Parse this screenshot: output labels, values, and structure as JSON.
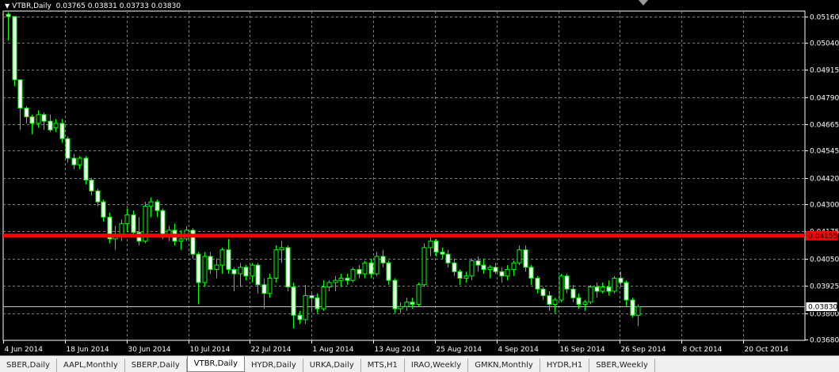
{
  "chart": {
    "symbol_label": "VTBR,Daily",
    "ohlc_label": "0.03765 0.03831 0.03733 0.03830",
    "line_price_label": "0.04155",
    "last_price_label": "0.03830",
    "colors": {
      "background": "#000000",
      "grid": "#7f7f7f",
      "candle": "#00ff00",
      "axis_text": "#ffffff",
      "support_line": "#ff0000"
    }
  },
  "chart_data": {
    "type": "candlestick",
    "title": "VTBR,Daily",
    "y_ticks": [
      "0.05160",
      "0.05040",
      "0.04915",
      "0.04790",
      "0.04665",
      "0.04545",
      "0.04420",
      "0.04300",
      "0.04175",
      "0.04050",
      "0.03925",
      "0.03800",
      "0.03680"
    ],
    "x_ticks": [
      "4 Jun 2014",
      "18 Jun 2014",
      "30 Jun 2014",
      "10 Jul 2014",
      "22 Jul 2014",
      "1 Aug 2014",
      "13 Aug 2014",
      "25 Aug 2014",
      "4 Sep 2014",
      "16 Sep 2014",
      "26 Sep 2014",
      "8 Oct 2014",
      "20 Oct 2014"
    ],
    "ylim": [
      0.0365,
      0.0519
    ],
    "horizontal_line": 0.04155,
    "last_close": 0.0383,
    "candles_ohlc": [
      [
        0.0517,
        0.0518,
        0.0505,
        0.0516
      ],
      [
        0.0516,
        0.0516,
        0.0484,
        0.0487
      ],
      [
        0.0487,
        0.0487,
        0.0464,
        0.0474
      ],
      [
        0.0474,
        0.0475,
        0.0467,
        0.047
      ],
      [
        0.047,
        0.0471,
        0.0462,
        0.0467
      ],
      [
        0.0467,
        0.0473,
        0.0465,
        0.0471
      ],
      [
        0.0471,
        0.0472,
        0.0464,
        0.0468
      ],
      [
        0.0468,
        0.0471,
        0.0463,
        0.0464
      ],
      [
        0.0465,
        0.0469,
        0.0463,
        0.0467
      ],
      [
        0.0467,
        0.0469,
        0.0458,
        0.046
      ],
      [
        0.046,
        0.0461,
        0.0449,
        0.0451
      ],
      [
        0.0451,
        0.0453,
        0.0446,
        0.0448
      ],
      [
        0.0448,
        0.0452,
        0.0446,
        0.0451
      ],
      [
        0.0451,
        0.0452,
        0.0439,
        0.0441
      ],
      [
        0.0441,
        0.0442,
        0.0434,
        0.0436
      ],
      [
        0.0436,
        0.0437,
        0.0429,
        0.0431
      ],
      [
        0.0431,
        0.0432,
        0.0422,
        0.0424
      ],
      [
        0.0424,
        0.0426,
        0.0412,
        0.0414
      ],
      [
        0.0414,
        0.042,
        0.0409,
        0.0416
      ],
      [
        0.0416,
        0.0423,
        0.0413,
        0.0421
      ],
      [
        0.0421,
        0.0428,
        0.0417,
        0.0425
      ],
      [
        0.0425,
        0.0427,
        0.0415,
        0.0417
      ],
      [
        0.0417,
        0.0424,
        0.0411,
        0.0413
      ],
      [
        0.0413,
        0.0431,
        0.0412,
        0.0429
      ],
      [
        0.0429,
        0.0433,
        0.0424,
        0.0431
      ],
      [
        0.0431,
        0.0432,
        0.0424,
        0.0427
      ],
      [
        0.0427,
        0.0428,
        0.0414,
        0.0416
      ],
      [
        0.0416,
        0.042,
        0.0413,
        0.0418
      ],
      [
        0.0418,
        0.0421,
        0.0411,
        0.0413
      ],
      [
        0.0413,
        0.0418,
        0.0409,
        0.0414
      ],
      [
        0.0414,
        0.042,
        0.0413,
        0.0418
      ],
      [
        0.0418,
        0.0419,
        0.0405,
        0.0407
      ],
      [
        0.0407,
        0.0408,
        0.0384,
        0.0394
      ],
      [
        0.0394,
        0.0408,
        0.0392,
        0.0406
      ],
      [
        0.0406,
        0.0408,
        0.0398,
        0.04
      ],
      [
        0.04,
        0.0405,
        0.0396,
        0.0402
      ],
      [
        0.0402,
        0.041,
        0.0398,
        0.0409
      ],
      [
        0.0409,
        0.0414,
        0.0398,
        0.04
      ],
      [
        0.04,
        0.0401,
        0.039,
        0.0398
      ],
      [
        0.0398,
        0.0403,
        0.0392,
        0.0401
      ],
      [
        0.0401,
        0.0402,
        0.0395,
        0.0397
      ],
      [
        0.0397,
        0.0403,
        0.0394,
        0.0402
      ],
      [
        0.0402,
        0.0403,
        0.0389,
        0.0393
      ],
      [
        0.0393,
        0.0396,
        0.0382,
        0.0389
      ],
      [
        0.0389,
        0.0398,
        0.0387,
        0.0396
      ],
      [
        0.0396,
        0.0411,
        0.0394,
        0.0409
      ],
      [
        0.0409,
        0.0413,
        0.0403,
        0.041
      ],
      [
        0.041,
        0.0411,
        0.039,
        0.0392
      ],
      [
        0.0392,
        0.0394,
        0.0373,
        0.0379
      ],
      [
        0.0379,
        0.0381,
        0.0375,
        0.0377
      ],
      [
        0.0377,
        0.0393,
        0.0375,
        0.0388
      ],
      [
        0.0388,
        0.0389,
        0.0381,
        0.0387
      ],
      [
        0.0387,
        0.0389,
        0.038,
        0.0382
      ],
      [
        0.0382,
        0.0395,
        0.0381,
        0.0392
      ],
      [
        0.0392,
        0.0395,
        0.039,
        0.0394
      ],
      [
        0.0394,
        0.0397,
        0.039,
        0.0395
      ],
      [
        0.0395,
        0.0398,
        0.0392,
        0.0396
      ],
      [
        0.0396,
        0.0398,
        0.0393,
        0.0395
      ],
      [
        0.0395,
        0.0401,
        0.0394,
        0.04
      ],
      [
        0.04,
        0.0402,
        0.0396,
        0.0398
      ],
      [
        0.0398,
        0.0404,
        0.0396,
        0.0403
      ],
      [
        0.0403,
        0.0405,
        0.0396,
        0.0398
      ],
      [
        0.0398,
        0.0408,
        0.0397,
        0.0406
      ],
      [
        0.0406,
        0.0409,
        0.0401,
        0.0403
      ],
      [
        0.0403,
        0.0404,
        0.0393,
        0.0395
      ],
      [
        0.0395,
        0.0396,
        0.038,
        0.0382
      ],
      [
        0.0382,
        0.0385,
        0.038,
        0.0383
      ],
      [
        0.0383,
        0.0387,
        0.0381,
        0.0385
      ],
      [
        0.0385,
        0.0387,
        0.0382,
        0.0384
      ],
      [
        0.0384,
        0.0394,
        0.0383,
        0.0393
      ],
      [
        0.0393,
        0.0412,
        0.0392,
        0.041
      ],
      [
        0.041,
        0.0415,
        0.0406,
        0.0413
      ],
      [
        0.0413,
        0.0414,
        0.0406,
        0.0408
      ],
      [
        0.0408,
        0.041,
        0.0405,
        0.0407
      ],
      [
        0.0407,
        0.0409,
        0.0401,
        0.0403
      ],
      [
        0.0403,
        0.0405,
        0.0397,
        0.0399
      ],
      [
        0.0399,
        0.04,
        0.0393,
        0.0396
      ],
      [
        0.0396,
        0.0399,
        0.0394,
        0.0397
      ],
      [
        0.0397,
        0.0405,
        0.0395,
        0.0404
      ],
      [
        0.0404,
        0.0406,
        0.0399,
        0.0402
      ],
      [
        0.0402,
        0.0405,
        0.0398,
        0.04
      ],
      [
        0.04,
        0.0402,
        0.0396,
        0.0401
      ],
      [
        0.0401,
        0.0403,
        0.0398,
        0.0399
      ],
      [
        0.0399,
        0.0401,
        0.0394,
        0.0397
      ],
      [
        0.0397,
        0.0402,
        0.0395,
        0.04
      ],
      [
        0.04,
        0.0404,
        0.0397,
        0.0403
      ],
      [
        0.0403,
        0.0411,
        0.0402,
        0.0409
      ],
      [
        0.0409,
        0.0411,
        0.0399,
        0.0401
      ],
      [
        0.0401,
        0.0402,
        0.0393,
        0.0396
      ],
      [
        0.0396,
        0.0397,
        0.0389,
        0.0391
      ],
      [
        0.0391,
        0.0392,
        0.0386,
        0.0388
      ],
      [
        0.0388,
        0.039,
        0.0381,
        0.0384
      ],
      [
        0.0384,
        0.0387,
        0.038,
        0.0386
      ],
      [
        0.0386,
        0.0398,
        0.0385,
        0.0397
      ],
      [
        0.0397,
        0.0398,
        0.0389,
        0.0391
      ],
      [
        0.0391,
        0.0393,
        0.0385,
        0.0387
      ],
      [
        0.0387,
        0.0389,
        0.0382,
        0.0384
      ],
      [
        0.0384,
        0.0386,
        0.0381,
        0.0385
      ],
      [
        0.0385,
        0.0393,
        0.0384,
        0.0392
      ],
      [
        0.0392,
        0.0394,
        0.0387,
        0.039
      ],
      [
        0.039,
        0.0394,
        0.0389,
        0.0392
      ],
      [
        0.0392,
        0.0395,
        0.0388,
        0.039
      ],
      [
        0.039,
        0.0397,
        0.0389,
        0.0396
      ],
      [
        0.0396,
        0.0399,
        0.0392,
        0.0394
      ],
      [
        0.0394,
        0.0395,
        0.0383,
        0.0386
      ],
      [
        0.0386,
        0.0387,
        0.0378,
        0.0379
      ],
      [
        0.0379,
        0.0384,
        0.0374,
        0.0383
      ]
    ]
  },
  "tabs": [
    {
      "label": "SBER,Daily"
    },
    {
      "label": "AAPL,Monthly"
    },
    {
      "label": "SBERP,Daily"
    },
    {
      "label": "VTBR,Daily"
    },
    {
      "label": "HYDR,Daily"
    },
    {
      "label": "URKA,Daily"
    },
    {
      "label": "MTS,H1"
    },
    {
      "label": "IRAO,Weekly"
    },
    {
      "label": "GMKN,Monthly"
    },
    {
      "label": "HYDR,H1"
    },
    {
      "label": "SBER,Weekly"
    }
  ],
  "active_tab": "VTBR,Daily"
}
